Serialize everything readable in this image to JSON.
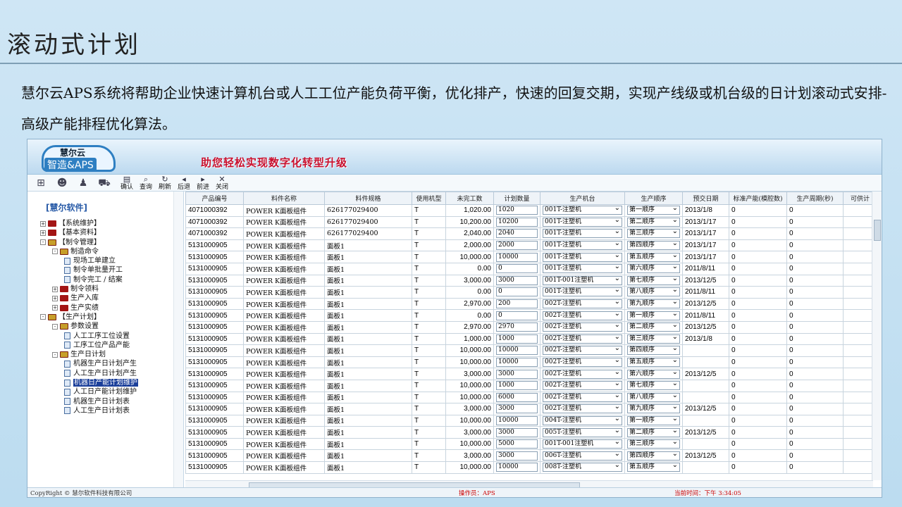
{
  "slide": {
    "title": "滚动式计划",
    "intro": "慧尔云APS系统将帮助企业快速计算机台或人工工位产能负荷平衡，优化排产，快速的回复交期，实现产线级或机台级的日计划滚动式安排-高级产能排程优化算法。"
  },
  "app": {
    "logo_name": "慧尔云",
    "logo_sub": "智造&APS",
    "slogan": "助您轻松实现数字化转型升级",
    "toolbar": [
      {
        "glyph": "▤",
        "label": "确认"
      },
      {
        "glyph": "⌕",
        "label": "查询"
      },
      {
        "glyph": "↻",
        "label": "刷新"
      },
      {
        "glyph": "◂",
        "label": "后退"
      },
      {
        "glyph": "▸",
        "label": "前进"
      },
      {
        "glyph": "✕",
        "label": "关闭"
      }
    ],
    "tree_title": "[慧尔软件]",
    "tree": [
      {
        "level": 0,
        "pm": "+",
        "icon": "book",
        "label": "【系统维护】"
      },
      {
        "level": 0,
        "pm": "+",
        "icon": "book",
        "label": "【基本资料】"
      },
      {
        "level": 0,
        "pm": "-",
        "icon": "book-open",
        "label": "【制令管理】"
      },
      {
        "level": 1,
        "pm": "-",
        "icon": "book-open",
        "label": "制造命令"
      },
      {
        "level": 2,
        "pm": "",
        "icon": "doc",
        "label": "现场工单建立"
      },
      {
        "level": 2,
        "pm": "",
        "icon": "doc",
        "label": "制令单批量开工"
      },
      {
        "level": 2,
        "pm": "",
        "icon": "doc",
        "label": "制令完工 / 结案"
      },
      {
        "level": 1,
        "pm": "+",
        "icon": "book",
        "label": "制令领料"
      },
      {
        "level": 1,
        "pm": "+",
        "icon": "book",
        "label": "生产入库"
      },
      {
        "level": 1,
        "pm": "+",
        "icon": "book",
        "label": "生产实绩"
      },
      {
        "level": 0,
        "pm": "-",
        "icon": "book-open",
        "label": "【生产计划】"
      },
      {
        "level": 1,
        "pm": "-",
        "icon": "book-open",
        "label": "参数设置"
      },
      {
        "level": 2,
        "pm": "",
        "icon": "doc",
        "label": "人工工序工位设置"
      },
      {
        "level": 2,
        "pm": "",
        "icon": "doc",
        "label": "工序工位产品产能"
      },
      {
        "level": 1,
        "pm": "-",
        "icon": "book-open",
        "label": "生产日计划"
      },
      {
        "level": 2,
        "pm": "",
        "icon": "doc",
        "label": "机器生产日计划产生"
      },
      {
        "level": 2,
        "pm": "",
        "icon": "doc",
        "label": "人工生产日计划产生"
      },
      {
        "level": 2,
        "pm": "",
        "icon": "doc",
        "label": "机器日产能计划维护",
        "selected": true
      },
      {
        "level": 2,
        "pm": "",
        "icon": "doc",
        "label": "人工日产能计划维护"
      },
      {
        "level": 2,
        "pm": "",
        "icon": "doc",
        "label": "机器生产日计划表"
      },
      {
        "level": 2,
        "pm": "",
        "icon": "doc",
        "label": "人工生产日计划表"
      }
    ],
    "columns": [
      "产品编号",
      "料件名称",
      "料件规格",
      "使用机型",
      "未完工数",
      "计划数量",
      "生产机台",
      "生产顺序",
      "预交日期",
      "标准产能(模腔数)",
      "生产周期(秒)",
      "可供计"
    ],
    "rows": [
      [
        "4071000392",
        "POWER K面板组件",
        "626177029400",
        "T",
        "1,020.00",
        "1020",
        "001T-注塑机",
        "第一顺序",
        "2013/1/8",
        "0",
        "0"
      ],
      [
        "4071000392",
        "POWER K面板组件",
        "626177029400",
        "T",
        "10,200.00",
        "10200",
        "001T-注塑机",
        "第二顺序",
        "2013/1/17",
        "0",
        "0"
      ],
      [
        "4071000392",
        "POWER K面板组件",
        "626177029400",
        "T",
        "2,040.00",
        "2040",
        "001T-注塑机",
        "第三顺序",
        "2013/1/17",
        "0",
        "0"
      ],
      [
        "5131000905",
        "POWER K面板组件",
        "面板1",
        "T",
        "2,000.00",
        "2000",
        "001T-注塑机",
        "第四顺序",
        "2013/1/17",
        "0",
        "0"
      ],
      [
        "5131000905",
        "POWER K面板组件",
        "面板1",
        "T",
        "10,000.00",
        "10000",
        "001T-注塑机",
        "第五顺序",
        "2013/1/17",
        "0",
        "0"
      ],
      [
        "5131000905",
        "POWER K面板组件",
        "面板1",
        "T",
        "0.00",
        "0",
        "001T-注塑机",
        "第六顺序",
        "2011/8/11",
        "0",
        "0"
      ],
      [
        "5131000905",
        "POWER K面板组件",
        "面板1",
        "T",
        "3,000.00",
        "3000",
        "001T-001注塑机",
        "第七顺序",
        "2013/12/5",
        "0",
        "0"
      ],
      [
        "5131000905",
        "POWER K面板组件",
        "面板1",
        "T",
        "0.00",
        "0",
        "001T-注塑机",
        "第八顺序",
        "2011/8/11",
        "0",
        "0"
      ],
      [
        "5131000905",
        "POWER K面板组件",
        "面板1",
        "T",
        "2,970.00",
        "200",
        "002T-注塑机",
        "第九顺序",
        "2013/12/5",
        "0",
        "0"
      ],
      [
        "5131000905",
        "POWER K面板组件",
        "面板1",
        "T",
        "0.00",
        "0",
        "002T-注塑机",
        "第一顺序",
        "2011/8/11",
        "0",
        "0"
      ],
      [
        "5131000905",
        "POWER K面板组件",
        "面板1",
        "T",
        "2,970.00",
        "2970",
        "002T-注塑机",
        "第二顺序",
        "2013/12/5",
        "0",
        "0"
      ],
      [
        "5131000905",
        "POWER K面板组件",
        "面板1",
        "T",
        "1,000.00",
        "1000",
        "002T-注塑机",
        "第三顺序",
        "2013/1/8",
        "0",
        "0"
      ],
      [
        "5131000905",
        "POWER K面板组件",
        "面板1",
        "T",
        "10,000.00",
        "10000",
        "002T-注塑机",
        "第四顺序",
        "",
        "0",
        "0"
      ],
      [
        "5131000905",
        "POWER K面板组件",
        "面板1",
        "T",
        "10,000.00",
        "10000",
        "002T-注塑机",
        "第五顺序",
        "",
        "0",
        "0"
      ],
      [
        "5131000905",
        "POWER K面板组件",
        "面板1",
        "T",
        "3,000.00",
        "3000",
        "002T-注塑机",
        "第六顺序",
        "2013/12/5",
        "0",
        "0"
      ],
      [
        "5131000905",
        "POWER K面板组件",
        "面板1",
        "T",
        "10,000.00",
        "1000",
        "002T-注塑机",
        "第七顺序",
        "",
        "0",
        "0"
      ],
      [
        "5131000905",
        "POWER K面板组件",
        "面板1",
        "T",
        "10,000.00",
        "6000",
        "002T-注塑机",
        "第八顺序",
        "",
        "0",
        "0"
      ],
      [
        "5131000905",
        "POWER K面板组件",
        "面板1",
        "T",
        "3,000.00",
        "3000",
        "002T-注塑机",
        "第九顺序",
        "2013/12/5",
        "0",
        "0"
      ],
      [
        "5131000905",
        "POWER K面板组件",
        "面板1",
        "T",
        "10,000.00",
        "10000",
        "004T-注塑机",
        "第一顺序",
        "",
        "0",
        "0"
      ],
      [
        "5131000905",
        "POWER K面板组件",
        "面板1",
        "T",
        "3,000.00",
        "3000",
        "005T-注塑机",
        "第二顺序",
        "2013/12/5",
        "0",
        "0"
      ],
      [
        "5131000905",
        "POWER K面板组件",
        "面板1",
        "T",
        "10,000.00",
        "5000",
        "001T-001注塑机",
        "第三顺序",
        "",
        "0",
        "0"
      ],
      [
        "5131000905",
        "POWER K面板组件",
        "面板1",
        "T",
        "3,000.00",
        "3000",
        "006T-注塑机",
        "第四顺序",
        "2013/12/5",
        "0",
        "0"
      ],
      [
        "5131000905",
        "POWER K面板组件",
        "面板1",
        "T",
        "10,000.00",
        "10000",
        "008T-注塑机",
        "第五顺序",
        "",
        "0",
        "0"
      ]
    ],
    "status": {
      "copyright": "CopyRight © 慧尔软件科技有限公司",
      "operator": "操作员：APS",
      "time": "当前时间：下午 3:34:05"
    }
  }
}
